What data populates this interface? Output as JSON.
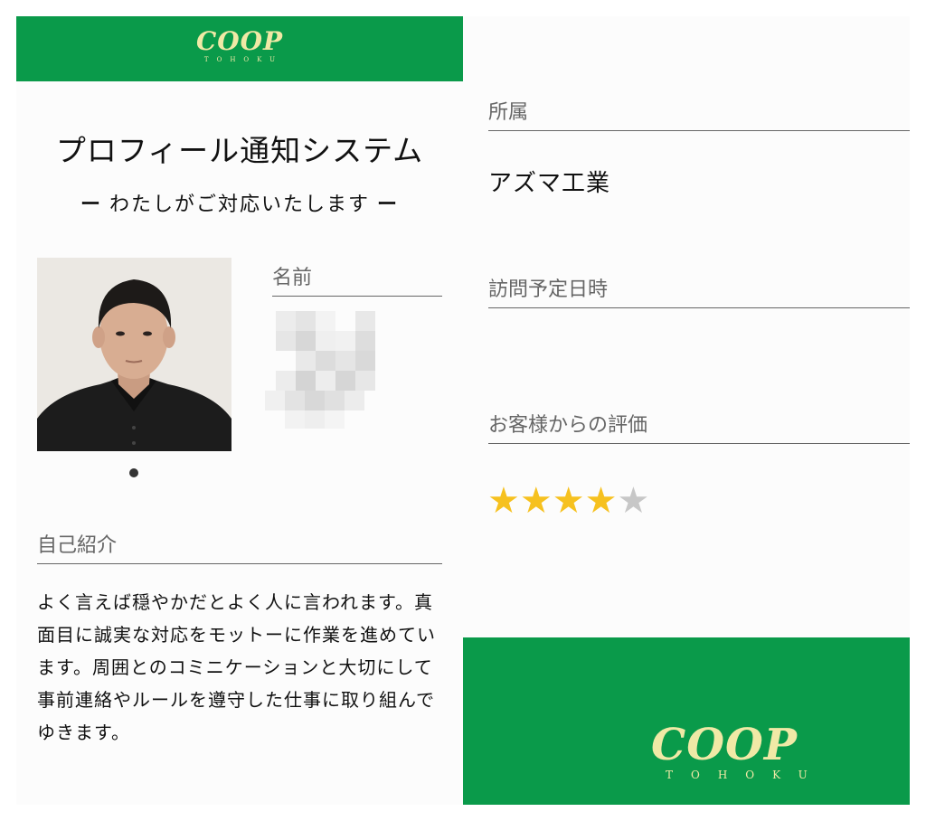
{
  "brand": {
    "logo_word": "COOP",
    "logo_sub": "TOHOKU"
  },
  "page": {
    "title": "プロフィール通知システム",
    "subtitle": "わたしがご対応いたします",
    "subtitle_dash": "ー"
  },
  "profile": {
    "name_label": "名前",
    "intro_label": "自己紹介",
    "intro_text": "よく言えば穏やかだとよく人に言われます。真面目に誠実な対応をモットーに作業を進めています。周囲とのコミニケーションと大切にして事前連絡やルールを遵守した仕事に取り組んでゆきます。",
    "affiliation_label": "所属",
    "affiliation_value": "アズマ工業",
    "visit_label": "訪問予定日時",
    "rating_label": "お客様からの評価",
    "rating": 4,
    "rating_max": 5
  },
  "icons": {
    "star": "star-icon",
    "photo": "staff-photo",
    "carousel": "carousel-dot"
  },
  "colors": {
    "brand_green": "#0a9a4a",
    "logo_cream": "#f0e9a6",
    "star_on": "#f6c11f",
    "star_off": "#c7c7c7"
  }
}
